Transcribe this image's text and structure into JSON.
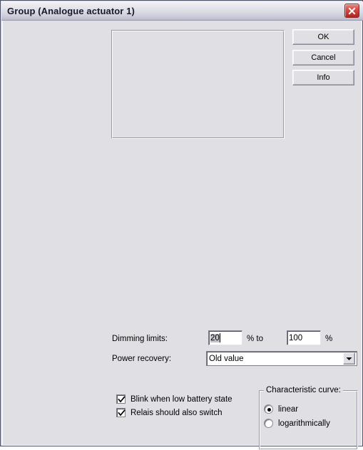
{
  "window": {
    "title": "Group (Analogue actuator 1)",
    "close_icon": "close-icon"
  },
  "buttons": {
    "ok": "OK",
    "cancel": "Cancel",
    "info": "Info"
  },
  "preview": {
    "content": ""
  },
  "form": {
    "dimming_limits_label": "Dimming limits:",
    "dimming_low_value": "20",
    "percent_to_label": "% to",
    "dimming_high_value": "100",
    "percent_label": "%",
    "power_recovery_label": "Power recovery:",
    "power_recovery_value": "Old value",
    "power_recovery_arrow_icon": "chevron-down-icon"
  },
  "checkboxes": [
    {
      "label": "Blink when low battery state",
      "checked": true
    },
    {
      "label": "Relais should also switch",
      "checked": true
    }
  ],
  "characteristic_curve": {
    "legend": "Characteristic curve:",
    "options": [
      {
        "label": "linear",
        "selected": true
      },
      {
        "label": "logarithmically",
        "selected": false
      }
    ]
  },
  "colors": {
    "dialog_face": "#dfdfe4",
    "title_gradient_top": "#f3f3f7",
    "title_gradient_bottom": "#b9b9c9",
    "close_button_red": "#c33833",
    "selection_gray": "#c0c0c8",
    "border_dark": "#4a4f63"
  }
}
